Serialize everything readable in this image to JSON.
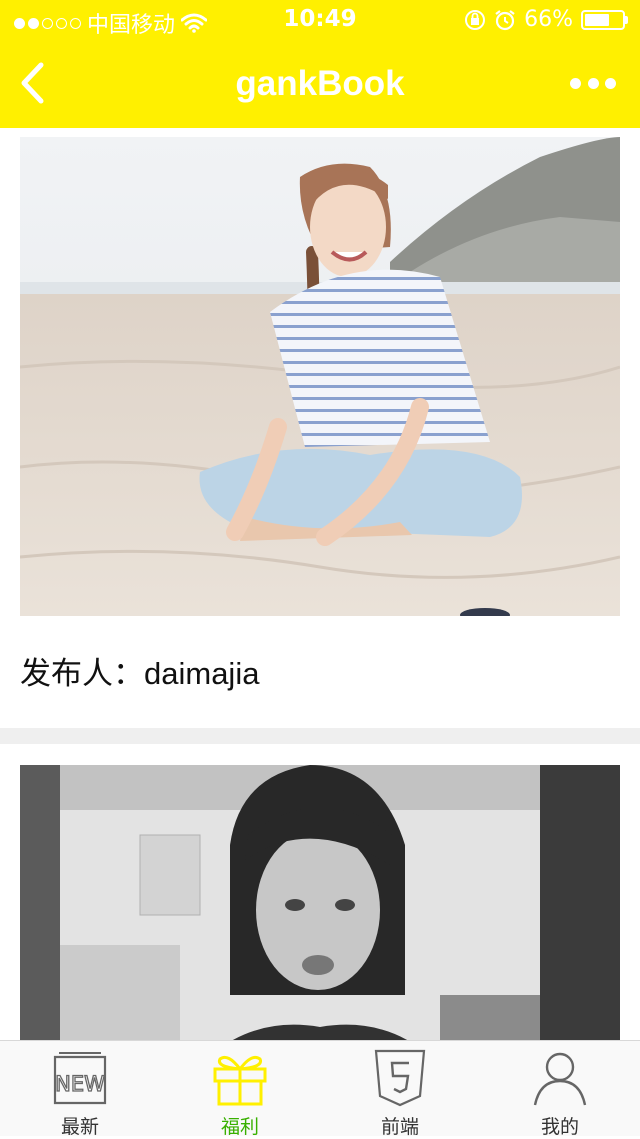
{
  "status_bar": {
    "carrier": "中国移动",
    "time": "10:49",
    "battery_text": "66%",
    "battery_level": 0.66,
    "signal_filled": 2,
    "signal_total": 5
  },
  "nav": {
    "title": "gankBook",
    "back_icon": "chevron-left-icon",
    "more_icon": "more-dots-icon"
  },
  "feed": {
    "items": [
      {
        "caption": "发布人：daimajia",
        "image": "beach-photo"
      },
      {
        "caption": "",
        "image": "portrait-photo"
      }
    ]
  },
  "tabs": [
    {
      "label": "最新",
      "icon": "new-icon",
      "active": false
    },
    {
      "label": "福利",
      "icon": "gift-icon",
      "active": true
    },
    {
      "label": "前端",
      "icon": "html5-icon",
      "active": false
    },
    {
      "label": "我的",
      "icon": "user-icon",
      "active": false
    }
  ],
  "colors": {
    "accent": "#FFF000",
    "active_tab": "#38b000",
    "divider": "#EFEFEF"
  }
}
